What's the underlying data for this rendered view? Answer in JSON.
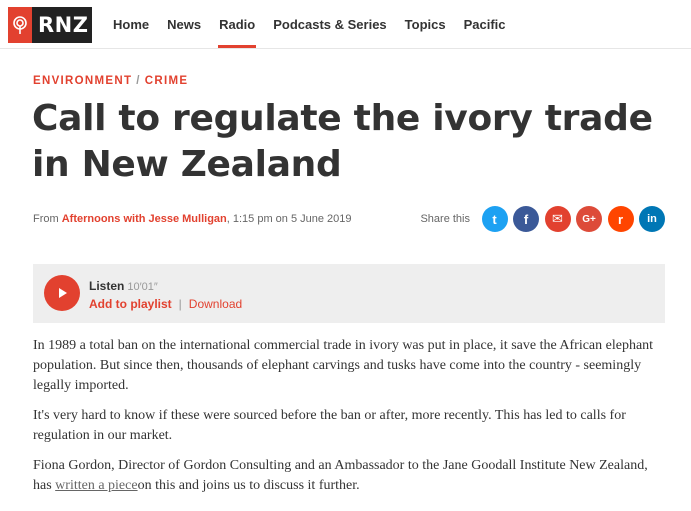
{
  "logo": {
    "text": "RNZ"
  },
  "nav": {
    "items": [
      {
        "label": "Home",
        "active": false
      },
      {
        "label": "News",
        "active": false
      },
      {
        "label": "Radio",
        "active": true
      },
      {
        "label": "Podcasts & Series",
        "active": false
      },
      {
        "label": "Topics",
        "active": false
      },
      {
        "label": "Pacific",
        "active": false
      }
    ]
  },
  "article": {
    "tags": [
      "ENVIRONMENT",
      "CRIME"
    ],
    "tag_separator": "/",
    "title": "Call to regulate the ivory trade in New Zealand",
    "byline": {
      "prefix": "From ",
      "programme": "Afternoons with Jesse Mulligan",
      "timestamp": ", 1:15 pm on 5 June 2019"
    },
    "share": {
      "label": "Share this",
      "buttons": [
        {
          "icon": "twitter-icon",
          "glyph": "t",
          "color": "#1da1f2"
        },
        {
          "icon": "facebook-icon",
          "glyph": "f",
          "color": "#3b5998"
        },
        {
          "icon": "email-icon",
          "glyph": "✉",
          "color": "#e2412f"
        },
        {
          "icon": "google-plus-icon",
          "glyph": "G+",
          "color": "#dd4b39"
        },
        {
          "icon": "reddit-icon",
          "glyph": "r",
          "color": "#ff4500"
        },
        {
          "icon": "linkedin-icon",
          "glyph": "in",
          "color": "#0077b5"
        }
      ]
    },
    "audio": {
      "listen_label": "Listen",
      "duration": "10′01″",
      "add_to_playlist": "Add to playlist",
      "separator": "|",
      "download": "Download"
    },
    "body": {
      "p1": "In 1989 a total ban on the international commercial trade in ivory was put in place, it save the African elephant population. But since then, thousands of elephant carvings and tusks have come into the country - seemingly legally imported.",
      "p2": "It's very hard to know if these were sourced before the ban or after, more recently. This has led to calls for regulation in our market.",
      "p3_before": "Fiona Gordon, Director of Gordon Consulting and an Ambassador to the Jane Goodall Institute New Zealand, has ",
      "p3_link": "written a piece",
      "p3_after": "on this and joins us to discuss it further."
    }
  },
  "colors": {
    "accent": "#e2412f",
    "logo_bg": "#222222",
    "listen_bg": "#eeeeee"
  }
}
